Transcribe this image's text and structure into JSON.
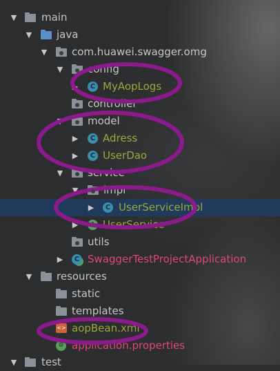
{
  "tree": {
    "rows": [
      {
        "label": "main",
        "arrow": "▼",
        "icon": "folder-icon",
        "kind": "folder"
      },
      {
        "label": "java",
        "arrow": "▼",
        "icon": "source-folder-icon",
        "kind": "source"
      },
      {
        "label": "com.huawei.swagger.omg",
        "arrow": "▼",
        "icon": "package-icon",
        "kind": "package"
      },
      {
        "label": "config",
        "arrow": "▼",
        "icon": "package-icon",
        "kind": "package"
      },
      {
        "label": "MyAopLogs",
        "arrow": "▶",
        "icon": "class-icon",
        "kind": "class"
      },
      {
        "label": "controller",
        "arrow": "",
        "icon": "package-icon",
        "kind": "package"
      },
      {
        "label": "model",
        "arrow": "▼",
        "icon": "package-icon",
        "kind": "package"
      },
      {
        "label": "Adress",
        "arrow": "▶",
        "icon": "class-icon",
        "kind": "class"
      },
      {
        "label": "UserDao",
        "arrow": "▶",
        "icon": "class-icon",
        "kind": "class"
      },
      {
        "label": "service",
        "arrow": "▼",
        "icon": "package-icon",
        "kind": "package"
      },
      {
        "label": "impl",
        "arrow": "▼",
        "icon": "package-icon",
        "kind": "package"
      },
      {
        "label": "UserServiceImpl",
        "arrow": "▶",
        "icon": "class-icon",
        "kind": "class"
      },
      {
        "label": "UserService",
        "arrow": "▶",
        "icon": "interface-icon",
        "kind": "interface"
      },
      {
        "label": "utils",
        "arrow": "",
        "icon": "package-icon",
        "kind": "package"
      },
      {
        "label": "SwaggerTestProjectApplication",
        "arrow": "▶",
        "icon": "spring-app-icon",
        "kind": "app"
      },
      {
        "label": "resources",
        "arrow": "▼",
        "icon": "resources-folder-icon",
        "kind": "resources"
      },
      {
        "label": "static",
        "arrow": "",
        "icon": "folder-icon",
        "kind": "folder"
      },
      {
        "label": "templates",
        "arrow": "",
        "icon": "folder-icon",
        "kind": "folder"
      },
      {
        "label": "aopBean.xml",
        "arrow": "",
        "icon": "xml-file-icon",
        "kind": "xml"
      },
      {
        "label": "application.properties",
        "arrow": "",
        "icon": "properties-file-icon",
        "kind": "props"
      },
      {
        "label": "test",
        "arrow": "▼",
        "icon": "folder-icon",
        "kind": "folder"
      }
    ]
  },
  "colors": {
    "background": "#2b2d2f",
    "selection": "#1f3a5a",
    "class_text": "#9ba83c",
    "app_text": "#e0467a",
    "annotation": "#8b1a8b"
  }
}
